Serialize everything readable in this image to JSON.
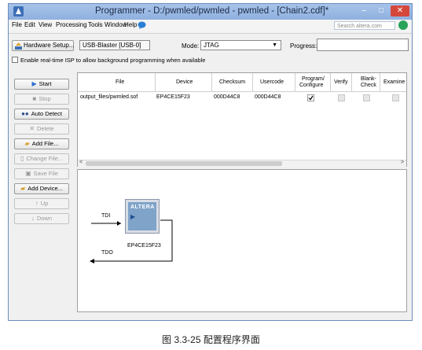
{
  "window": {
    "title": "Programmer - D:/pwmled/pwmled - pwmled - [Chain2.cdf]*",
    "minimize": "–",
    "maximize": "□",
    "close": "✕"
  },
  "menu": [
    "File",
    "Edit",
    "View",
    "Processing",
    "Tools",
    "Window",
    "Help"
  ],
  "search": {
    "placeholder": "Search altera.com"
  },
  "toolbar": {
    "hardware_setup_label": "Hardware Setup...",
    "hardware_value": "USB-Blaster [USB-0]",
    "mode_label": "Mode:",
    "mode_value": "JTAG",
    "progress_label": "Progress:",
    "progress_value": "",
    "isp_label": "Enable real-time ISP to allow background programming when available"
  },
  "side_buttons": [
    {
      "label": "Start",
      "enabled": true
    },
    {
      "label": "Stop",
      "enabled": false
    },
    {
      "label": "Auto Detect",
      "enabled": true
    },
    {
      "label": "Delete",
      "enabled": false
    },
    {
      "label": "Add File...",
      "enabled": true
    },
    {
      "label": "Change File...",
      "enabled": false
    },
    {
      "label": "Save File",
      "enabled": false
    },
    {
      "label": "Add Device...",
      "enabled": true
    },
    {
      "label": "Up",
      "enabled": false
    },
    {
      "label": "Down",
      "enabled": false
    }
  ],
  "table": {
    "headers": {
      "file": "File",
      "device": "Device",
      "checksum": "Checksum",
      "usercode": "Usercode",
      "program1": "Program/",
      "program2": "Configure",
      "verify": "Verify",
      "blank1": "Blank-",
      "blank2": "Check",
      "examine": "Examine"
    },
    "rows": [
      {
        "file": "output_files/pwmled.sof",
        "device": "EP4CE15F23",
        "checksum": "000D44C8",
        "usercode": "000D44C8",
        "program": true,
        "verify": false,
        "blank": false,
        "examine": false
      }
    ]
  },
  "diagram": {
    "tdi": "TDI",
    "tdo": "TDO",
    "chip_logo": "ALTERA",
    "device": "EP4CE15F23"
  },
  "caption": "图 3.3-25 配置程序界面",
  "colors": {
    "titlebar": "#9bbbe4",
    "close": "#d6473b",
    "chip": "#7fa3c9"
  }
}
